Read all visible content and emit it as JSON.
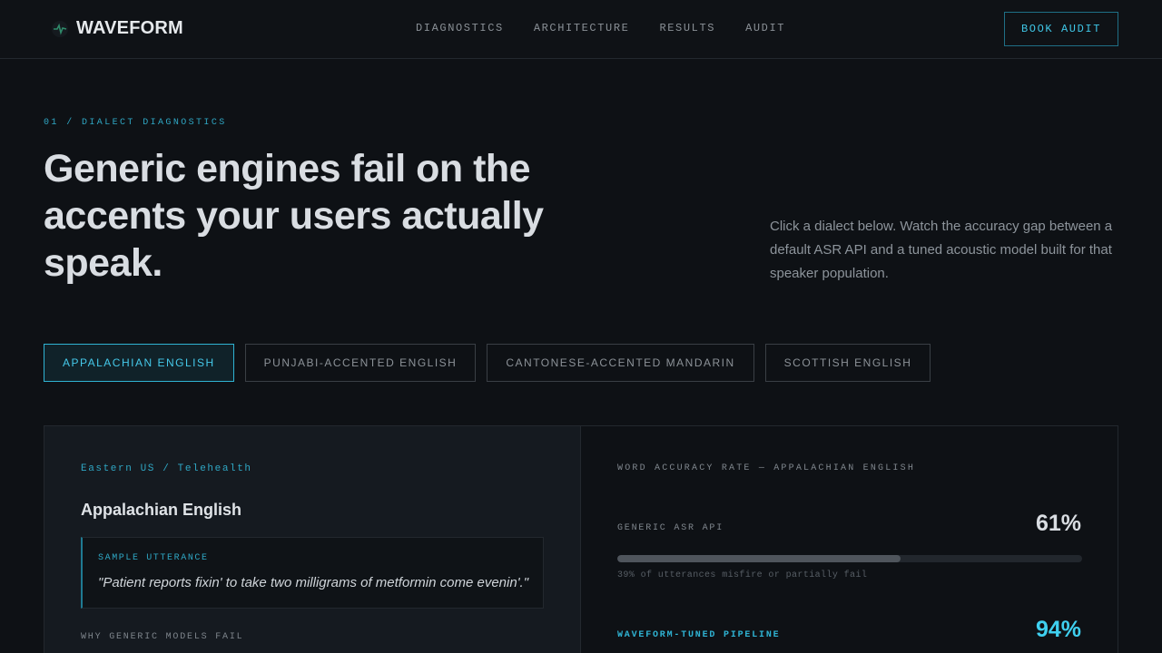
{
  "brand": {
    "name": "WAVEFORM",
    "icon": "waveform-logo-icon",
    "accent": "#2fb3d3"
  },
  "nav": {
    "items": [
      {
        "label": "DIAGNOSTICS"
      },
      {
        "label": "ARCHITECTURE"
      },
      {
        "label": "RESULTS"
      },
      {
        "label": "AUDIT"
      }
    ],
    "cta_label": "BOOK AUDIT"
  },
  "hero": {
    "eyebrow": "01 / DIALECT DIAGNOSTICS",
    "headline": "Generic engines fail on the accents your users actually speak.",
    "intro": "Click a dialect below. Watch the accuracy gap between a default ASR API and a tuned acoustic model built for that speaker population."
  },
  "tabs": [
    {
      "label": "APPALACHIAN ENGLISH",
      "active": true
    },
    {
      "label": "PUNJABI-ACCENTED ENGLISH",
      "active": false
    },
    {
      "label": "CANTONESE-ACCENTED MANDARIN",
      "active": false
    },
    {
      "label": "SCOTTISH ENGLISH",
      "active": false
    }
  ],
  "detail": {
    "region": "Eastern US / Telehealth",
    "dialect_name": "Appalachian English",
    "utterance_label": "SAMPLE UTTERANCE",
    "utterance_text": "\"Patient reports fixin' to take two milligrams of metformin come evenin'.\"",
    "why_label": "WHY GENERIC MODELS FAIL"
  },
  "accuracy": {
    "title": "WORD ACCURACY RATE — APPALACHIAN ENGLISH",
    "generic": {
      "label": "GENERIC ASR API",
      "value_text": "61%",
      "value": 61,
      "note": "39% of utterances misfire or partially fail"
    },
    "tuned": {
      "label": "WAVEFORM-TUNED PIPELINE",
      "value_text": "94%",
      "value": 94
    }
  }
}
